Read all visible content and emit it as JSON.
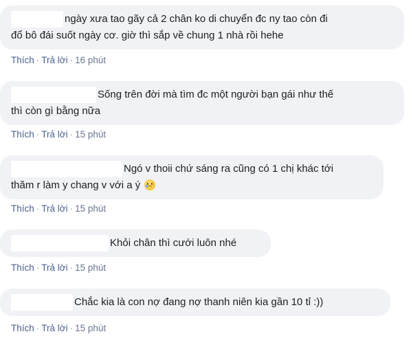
{
  "actions": {
    "like": "Thích",
    "reply": "Trả lời",
    "separator": "·"
  },
  "comments": [
    {
      "lines": [
        "ngày xưa tao gãy cả 2 chân ko di chuyển đc ny tao còn đi",
        "đổ bô đái suốt ngày cơ. giờ thì sắp về chung 1 nhà rồi hehe"
      ],
      "time": "16 phút"
    },
    {
      "lines": [
        "Sống trên đời mà tìm đc một người bạn gái như thế",
        "thì còn gì bằng nữa"
      ],
      "time": "15 phút"
    },
    {
      "lines": [
        "Ngó v thoii chứ sáng ra cũng có 1 chị khác tới",
        "thăm r làm y chang v với a ý"
      ],
      "emoji": "crying-face",
      "time": "15 phút"
    },
    {
      "lines": [
        "Khỏi chân thì cưới luôn nhé"
      ],
      "time": "15 phút"
    },
    {
      "lines": [
        "Chắc kia là con nợ đang nợ thanh niên kia gần 10 tỉ :))"
      ],
      "time": "15 phút"
    }
  ]
}
